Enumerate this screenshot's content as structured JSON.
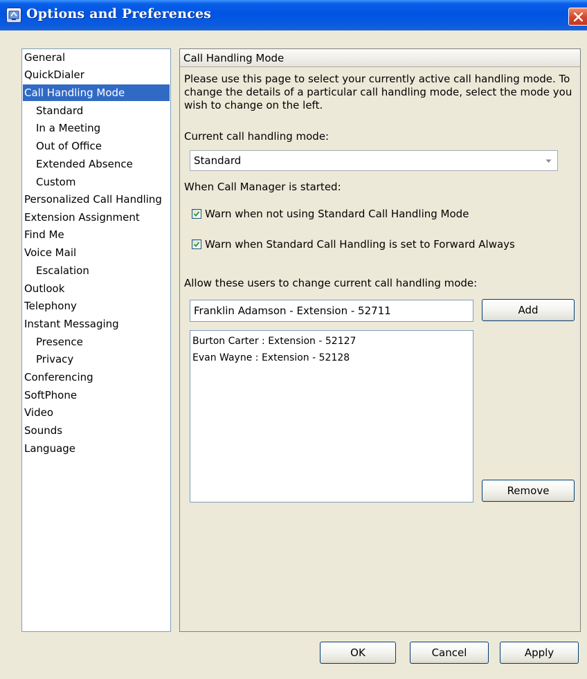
{
  "window": {
    "title": "Options and Preferences"
  },
  "nav": {
    "items": [
      {
        "label": "General"
      },
      {
        "label": "QuickDialer"
      },
      {
        "label": "Call Handling Mode"
      },
      {
        "label": "Standard"
      },
      {
        "label": "In a Meeting"
      },
      {
        "label": "Out of Office"
      },
      {
        "label": "Extended Absence"
      },
      {
        "label": "Custom"
      },
      {
        "label": "Personalized Call Handling"
      },
      {
        "label": "Extension Assignment"
      },
      {
        "label": "Find Me"
      },
      {
        "label": "Voice Mail"
      },
      {
        "label": "Escalation"
      },
      {
        "label": "Outlook"
      },
      {
        "label": "Telephony"
      },
      {
        "label": "Instant Messaging"
      },
      {
        "label": "Presence"
      },
      {
        "label": "Privacy"
      },
      {
        "label": "Conferencing"
      },
      {
        "label": "SoftPhone"
      },
      {
        "label": "Video"
      },
      {
        "label": "Sounds"
      },
      {
        "label": "Language"
      }
    ],
    "selected": "Call Handling Mode"
  },
  "panel": {
    "header": "Call Handling Mode",
    "description_lines": [
      "Please use this page to select your currently active call handling mode. To",
      "change the details of a particular call handling mode, select the mode you",
      "wish to change on the left."
    ],
    "current_mode_label": "Current call handling mode:",
    "current_mode_value": "Standard",
    "startup_label": "When Call Manager is started:",
    "checkbox_warn_standard": {
      "label": "Warn when not using Standard Call Handling Mode",
      "checked": true
    },
    "checkbox_warn_forward": {
      "label": "Warn when Standard Call Handling is set to Forward Always",
      "checked": true
    },
    "allow_users_label": "Allow these users to change current call handling mode:",
    "user_input_value": "Franklin Adamson - Extension - 52711",
    "add_button": "Add",
    "users": [
      "Burton Carter : Extension - 52127",
      "Evan Wayne : Extension - 52128"
    ],
    "remove_button": "Remove"
  },
  "footer": {
    "ok": "OK",
    "cancel": "Cancel",
    "apply": "Apply"
  },
  "icons": {
    "window": "options-app-icon",
    "close": "close-icon",
    "dropdown": "chevron-down-icon",
    "check": "checkmark-icon"
  },
  "colors": {
    "selection": "#316ac5",
    "titlebar": "#0054e3",
    "close": "#d5442b"
  }
}
